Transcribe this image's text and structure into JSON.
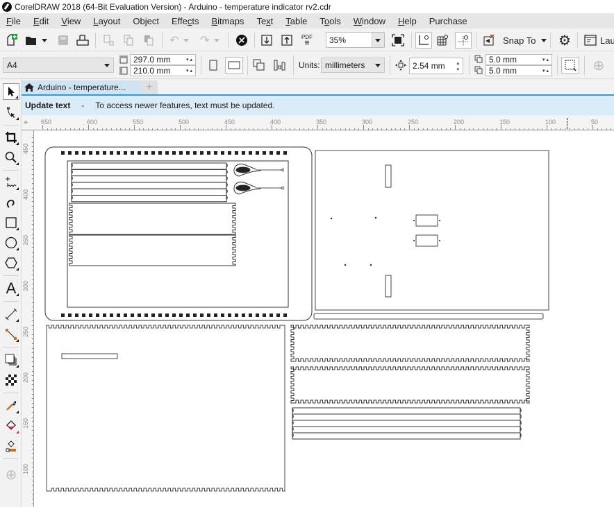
{
  "window": {
    "title": "CorelDRAW 2018 (64-Bit Evaluation Version) - Arduino - temperature indicator rv2.cdr"
  },
  "menu": [
    {
      "label": "File",
      "key": "F"
    },
    {
      "label": "Edit",
      "key": "E"
    },
    {
      "label": "View",
      "key": "V"
    },
    {
      "label": "Layout",
      "key": "L"
    },
    {
      "label": "Object",
      "key": "j"
    },
    {
      "label": "Effects",
      "key": "c"
    },
    {
      "label": "Bitmaps",
      "key": "B"
    },
    {
      "label": "Text",
      "key": "x"
    },
    {
      "label": "Table",
      "key": "T"
    },
    {
      "label": "Tools",
      "key": "o"
    },
    {
      "label": "Window",
      "key": "W"
    },
    {
      "label": "Help",
      "key": "H"
    },
    {
      "label": "Purchase",
      "key": ""
    }
  ],
  "toolbar": {
    "zoom_level": "35%",
    "snap_to_label": "Snap To",
    "launch_label": "Lau",
    "pdf_label": "PDF"
  },
  "property_bar": {
    "page_size": "A4",
    "page_width": "297.0 mm",
    "page_height": "210.0 mm",
    "units_label": "Units:",
    "units_value": "millimeters",
    "nudge": "2.54 mm",
    "dup_x": "5.0 mm",
    "dup_y": "5.0 mm"
  },
  "document_tabs": [
    {
      "label": "Arduino - temperature..."
    }
  ],
  "infobar": {
    "title": "Update text",
    "separator": "-",
    "message": "To access newer features, text must be updated."
  },
  "rulers": {
    "horizontal": [
      "650",
      "600",
      "550",
      "500",
      "450",
      "400",
      "350",
      "300",
      "250",
      "200",
      "150",
      "100",
      "50"
    ],
    "vertical": [
      "450",
      "400",
      "350",
      "300",
      "250",
      "200",
      "150",
      "100"
    ]
  },
  "tools": [
    {
      "name": "pick-tool"
    },
    {
      "name": "shape-tool"
    },
    {
      "name": "crop-tool"
    },
    {
      "name": "zoom-tool"
    },
    {
      "name": "freehand-tool"
    },
    {
      "name": "artistic-media-tool"
    },
    {
      "name": "rectangle-tool"
    },
    {
      "name": "ellipse-tool"
    },
    {
      "name": "polygon-tool"
    },
    {
      "name": "text-tool"
    },
    {
      "name": "parallel-dimension-tool"
    },
    {
      "name": "connector-tool"
    },
    {
      "name": "drop-shadow-tool"
    },
    {
      "name": "transparency-tool"
    },
    {
      "name": "color-eyedropper-tool"
    },
    {
      "name": "interactive-fill-tool"
    },
    {
      "name": "smart-fill-tool"
    },
    {
      "name": "add-tool"
    }
  ],
  "colors": {
    "accent": "#3a9bc8",
    "infobar_bg": "#dcebf8",
    "tab_bg": "#cfe3f3"
  }
}
